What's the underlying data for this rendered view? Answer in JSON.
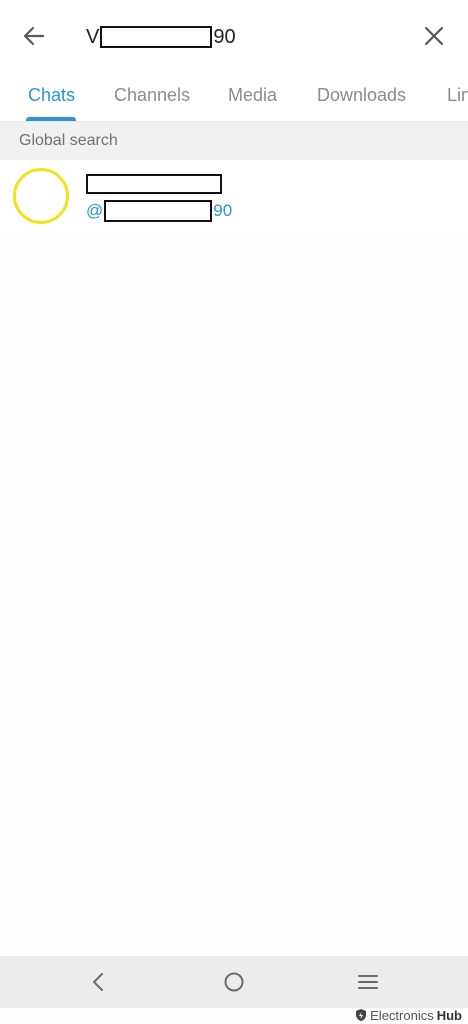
{
  "search": {
    "query_prefix": "V",
    "query_suffix": "90"
  },
  "tabs": [
    {
      "label": "Chats",
      "active": true
    },
    {
      "label": "Channels",
      "active": false
    },
    {
      "label": "Media",
      "active": false
    },
    {
      "label": "Downloads",
      "active": false
    },
    {
      "label": "Lin",
      "active": false
    }
  ],
  "section": {
    "global_search_label": "Global search"
  },
  "results": [
    {
      "username_prefix": "@",
      "username_suffix": "90",
      "avatar_ring_color": "#f3e21a"
    }
  ],
  "icons": {
    "back": "back-arrow-icon",
    "close": "close-x-icon",
    "nav_back": "chevron-left-icon",
    "nav_home": "circle-home-icon",
    "nav_menu": "hamburger-menu-icon"
  },
  "colors": {
    "accent": "#2b95d6",
    "tab_inactive": "#8a8d90",
    "section_bg": "#f1f1f1",
    "navbar_bg": "#ececec"
  },
  "watermark": {
    "brand_light": "Electronics",
    "brand_bold": "Hub"
  }
}
